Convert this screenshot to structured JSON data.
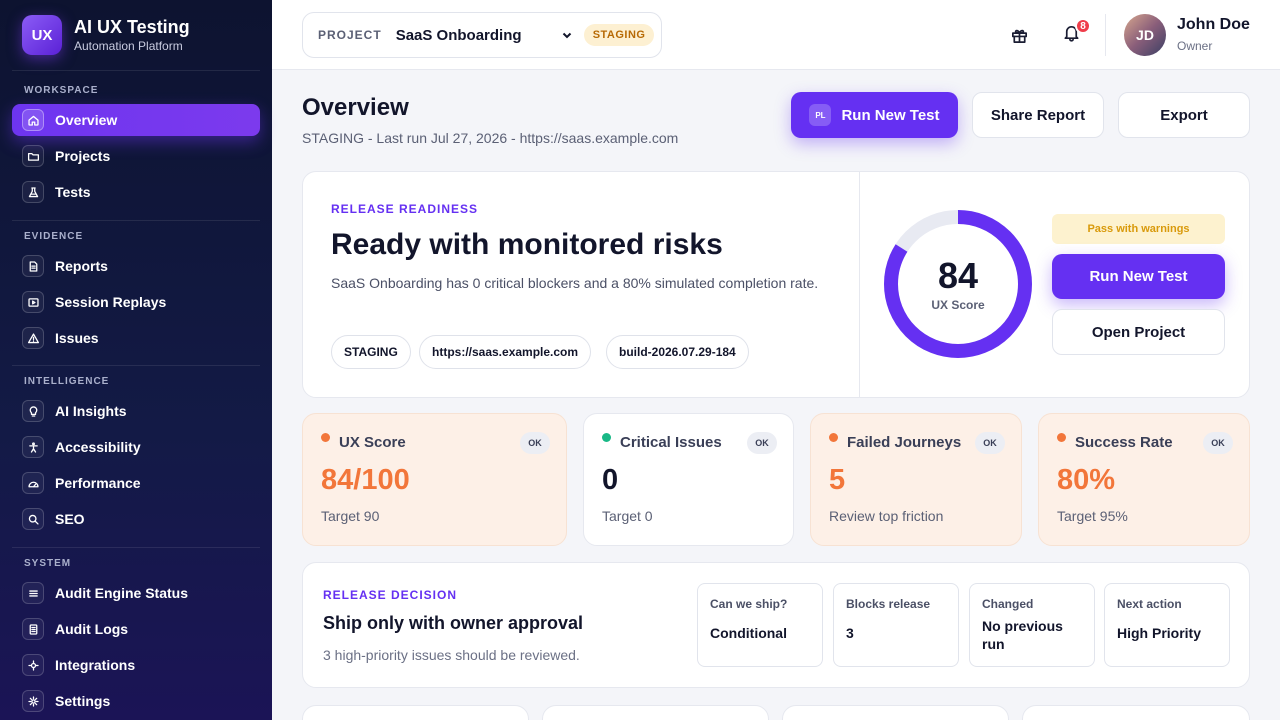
{
  "brand": {
    "logo": "UX",
    "title": "AI UX Testing",
    "subtitle": "Automation Platform"
  },
  "sidebar": {
    "sections": [
      {
        "label": "WORKSPACE",
        "items": [
          {
            "label": "Overview",
            "icon": "home-icon",
            "active": true
          },
          {
            "label": "Projects",
            "icon": "folder-icon"
          },
          {
            "label": "Tests",
            "icon": "flask-icon"
          }
        ]
      },
      {
        "label": "EVIDENCE",
        "items": [
          {
            "label": "Reports",
            "icon": "document-icon"
          },
          {
            "label": "Session Replays",
            "icon": "play-icon"
          },
          {
            "label": "Issues",
            "icon": "warning-icon"
          }
        ]
      },
      {
        "label": "INTELLIGENCE",
        "items": [
          {
            "label": "AI Insights",
            "icon": "lightbulb-icon"
          },
          {
            "label": "Accessibility",
            "icon": "accessibility-icon"
          },
          {
            "label": "Performance",
            "icon": "speedometer-icon"
          },
          {
            "label": "SEO",
            "icon": "search-icon"
          }
        ]
      },
      {
        "label": "SYSTEM",
        "items": [
          {
            "label": "Audit Engine Status",
            "icon": "list-icon"
          },
          {
            "label": "Audit Logs",
            "icon": "log-icon"
          },
          {
            "label": "Integrations",
            "icon": "integrations-icon"
          },
          {
            "label": "Settings",
            "icon": "gear-icon"
          }
        ]
      }
    ]
  },
  "topbar": {
    "project_label": "PROJECT",
    "project_name": "SaaS Onboarding",
    "env": "STAGING",
    "notifications": "8",
    "user": {
      "initials": "JD",
      "name": "John Doe",
      "role": "Owner"
    }
  },
  "header": {
    "title": "Overview",
    "subtitle": "STAGING - Last run Jul 27, 2026 - https://saas.example.com",
    "run_badge": "PL",
    "run_label": "Run New Test",
    "share_label": "Share Report",
    "export_label": "Export"
  },
  "readiness": {
    "eyebrow": "RELEASE READINESS",
    "title": "Ready with monitored risks",
    "description": "SaaS Onboarding has 0 critical blockers and a 80% simulated completion rate.",
    "tags": [
      "STAGING",
      "https://saas.example.com",
      "build-2026.07.29-184"
    ],
    "score": "84",
    "score_value": 84,
    "score_max": 100,
    "score_label": "UX Score",
    "status": "Pass with warnings",
    "run_label": "Run New Test",
    "open_label": "Open Project"
  },
  "kpis": [
    {
      "title": "UX Score",
      "badge": "OK",
      "value": "84/100",
      "foot": "Target 90",
      "dot": "#f2763a",
      "value_color": "#f2763a"
    },
    {
      "title": "Critical Issues",
      "badge": "OK",
      "value": "0",
      "foot": "Target 0",
      "dot": "#19b886",
      "value_color": "#12152b"
    },
    {
      "title": "Failed Journeys",
      "badge": "OK",
      "value": "5",
      "foot": "Review top friction",
      "dot": "#f2763a",
      "value_color": "#f2763a"
    },
    {
      "title": "Success Rate",
      "badge": "OK",
      "value": "80%",
      "foot": "Target 95%",
      "dot": "#f2763a",
      "value_color": "#f2763a"
    }
  ],
  "decision": {
    "eyebrow": "RELEASE DECISION",
    "title": "Ship only with owner approval",
    "subtitle": "3 high-priority issues should be reviewed.",
    "facts": [
      {
        "label": "Can we ship?",
        "value": "Conditional"
      },
      {
        "label": "Blocks release",
        "value": "3"
      },
      {
        "label": "Changed",
        "value": "No previous run"
      },
      {
        "label": "Next action",
        "value": "High Priority"
      }
    ]
  },
  "colors": {
    "accent": "#6530f2",
    "warning": "#f2763a",
    "success": "#19b886",
    "sidebar": "#0d1330"
  }
}
